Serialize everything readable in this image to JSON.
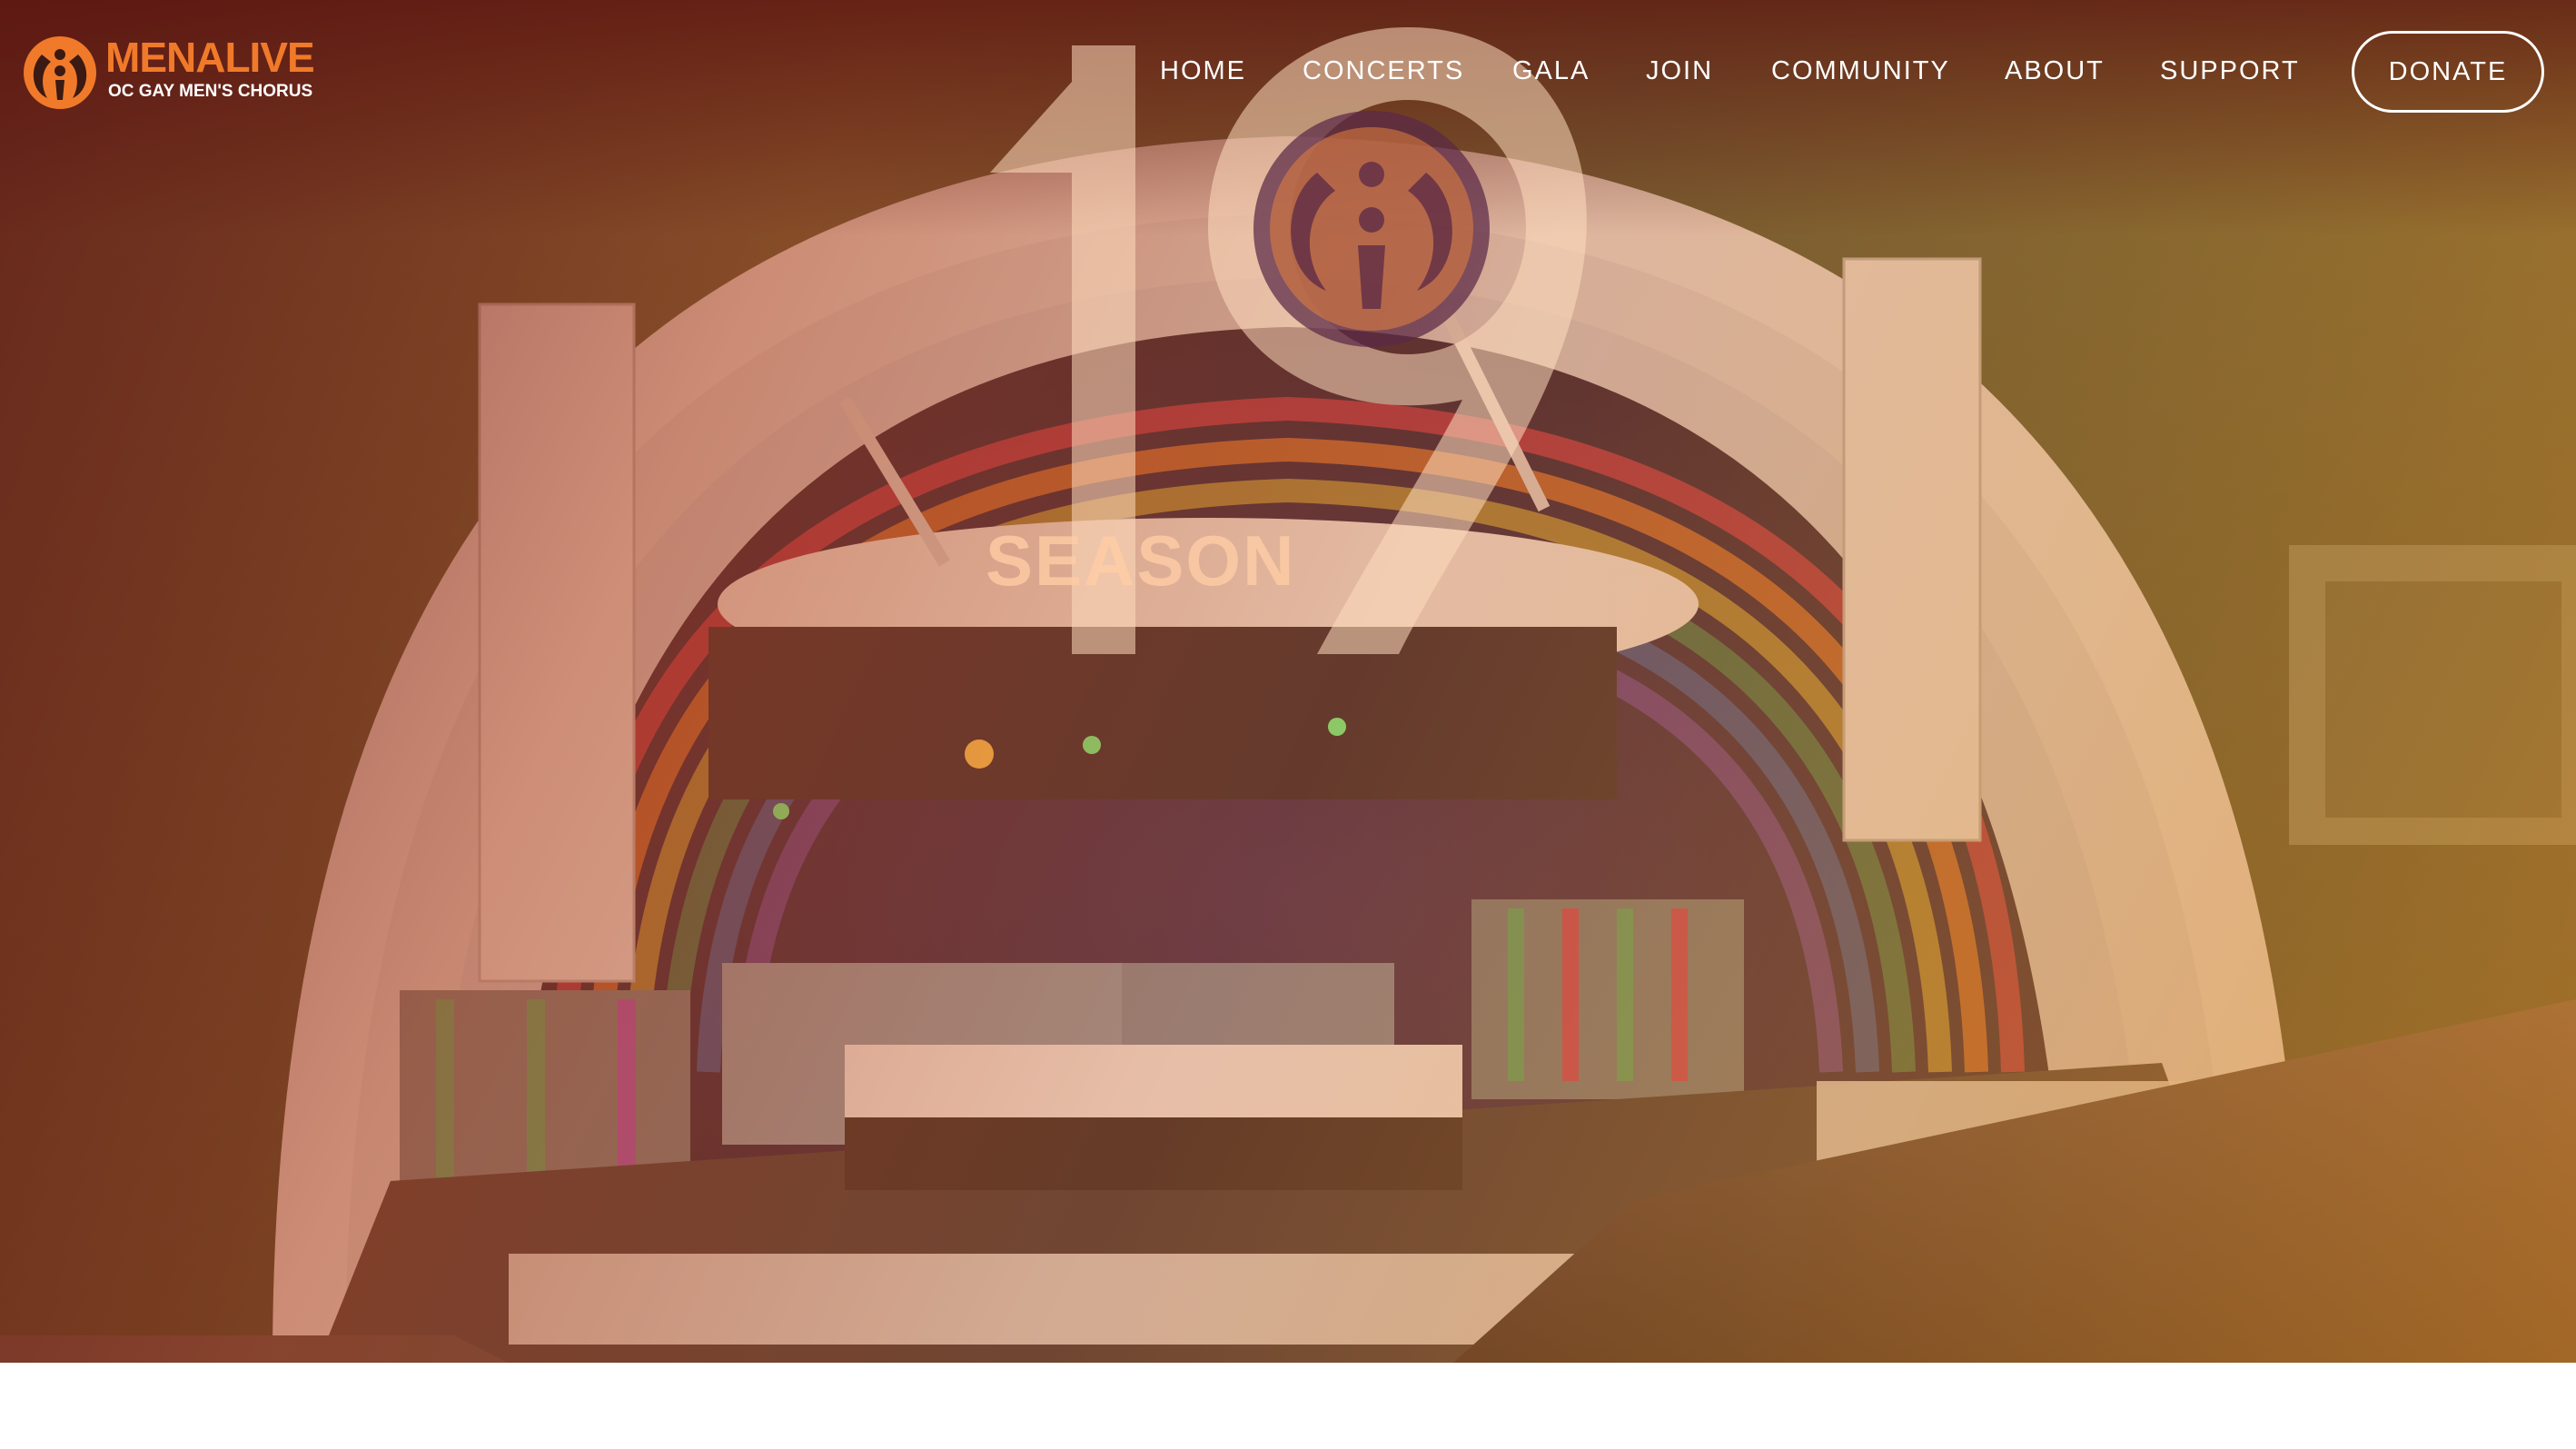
{
  "header": {
    "logo": {
      "name": "MENALIVE",
      "tagline": "OC GAY MEN'S CHORUS",
      "icon": "menalive-logo-icon"
    },
    "nav": [
      {
        "label": "HOME"
      },
      {
        "label": "CONCERTS"
      },
      {
        "label": "GALA"
      },
      {
        "label": "JOIN"
      },
      {
        "label": "COMMUNITY"
      },
      {
        "label": "ABOUT"
      },
      {
        "label": "SUPPORT"
      }
    ],
    "donate_label": "DONATE"
  },
  "hero": {
    "season_number": "19",
    "season_label": "SEASON",
    "image": "chorus-performing-at-hollywood-bowl-photo"
  },
  "colors": {
    "brand_orange": "#f07a2a",
    "overlay_deep": "#6e1914",
    "overlay_warm": "#e18c28",
    "nav_text": "#ffffff",
    "page_background": "#ffffff"
  }
}
